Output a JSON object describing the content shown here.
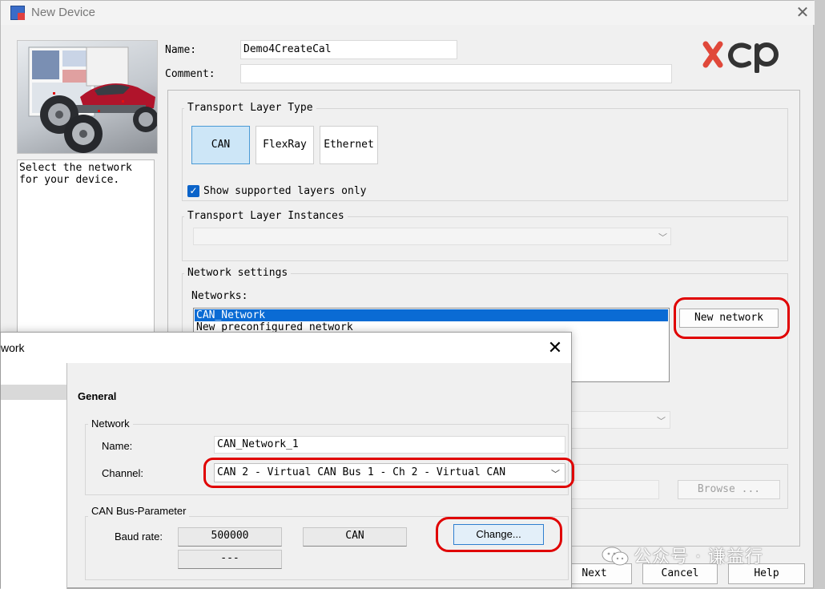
{
  "window": {
    "title": "New Device"
  },
  "info_text": "Select the network\nfor your device.",
  "form": {
    "name_label": "Name:",
    "name_value": "Demo4CreateCal",
    "comment_label": "Comment:",
    "comment_value": ""
  },
  "transport_type": {
    "title": "Transport Layer Type",
    "buttons": [
      "CAN",
      "FlexRay",
      "Ethernet"
    ],
    "selected": "CAN",
    "checkbox_label": "Show supported layers only",
    "checkbox_checked": true
  },
  "transport_instances": {
    "title": "Transport Layer Instances"
  },
  "network_settings": {
    "title": "Network settings",
    "networks_label": "Networks:",
    "items": [
      "CAN_Network",
      "New preconfigured network"
    ],
    "selected_index": 0,
    "new_network_button": "New network"
  },
  "browse_button": "Browse ...",
  "footer_buttons": {
    "next": "Next",
    "cancel": "Cancel",
    "help": "Help"
  },
  "dialog": {
    "title": "work",
    "section": "General",
    "network_group": "Network",
    "name_label": "Name:",
    "name_value": "CAN_Network_1",
    "channel_label": "Channel:",
    "channel_value": "CAN 2 - Virtual CAN Bus 1 - Ch 2 -  Virtual CAN",
    "bus_group": "CAN Bus-Parameter",
    "baud_label": "Baud rate:",
    "baud_value": "500000",
    "bus_type": "CAN",
    "secondary_value": "---",
    "change_button": "Change..."
  },
  "watermark": "公众号 · 谦益行",
  "colors": {
    "highlight_red": "#e00000",
    "selection_blue": "#0a6bd4",
    "selected_button": "#cde6f7"
  },
  "icons": [
    "app-icon",
    "close-icon",
    "chevron-down-icon",
    "checkmark-icon",
    "wechat-icon"
  ]
}
